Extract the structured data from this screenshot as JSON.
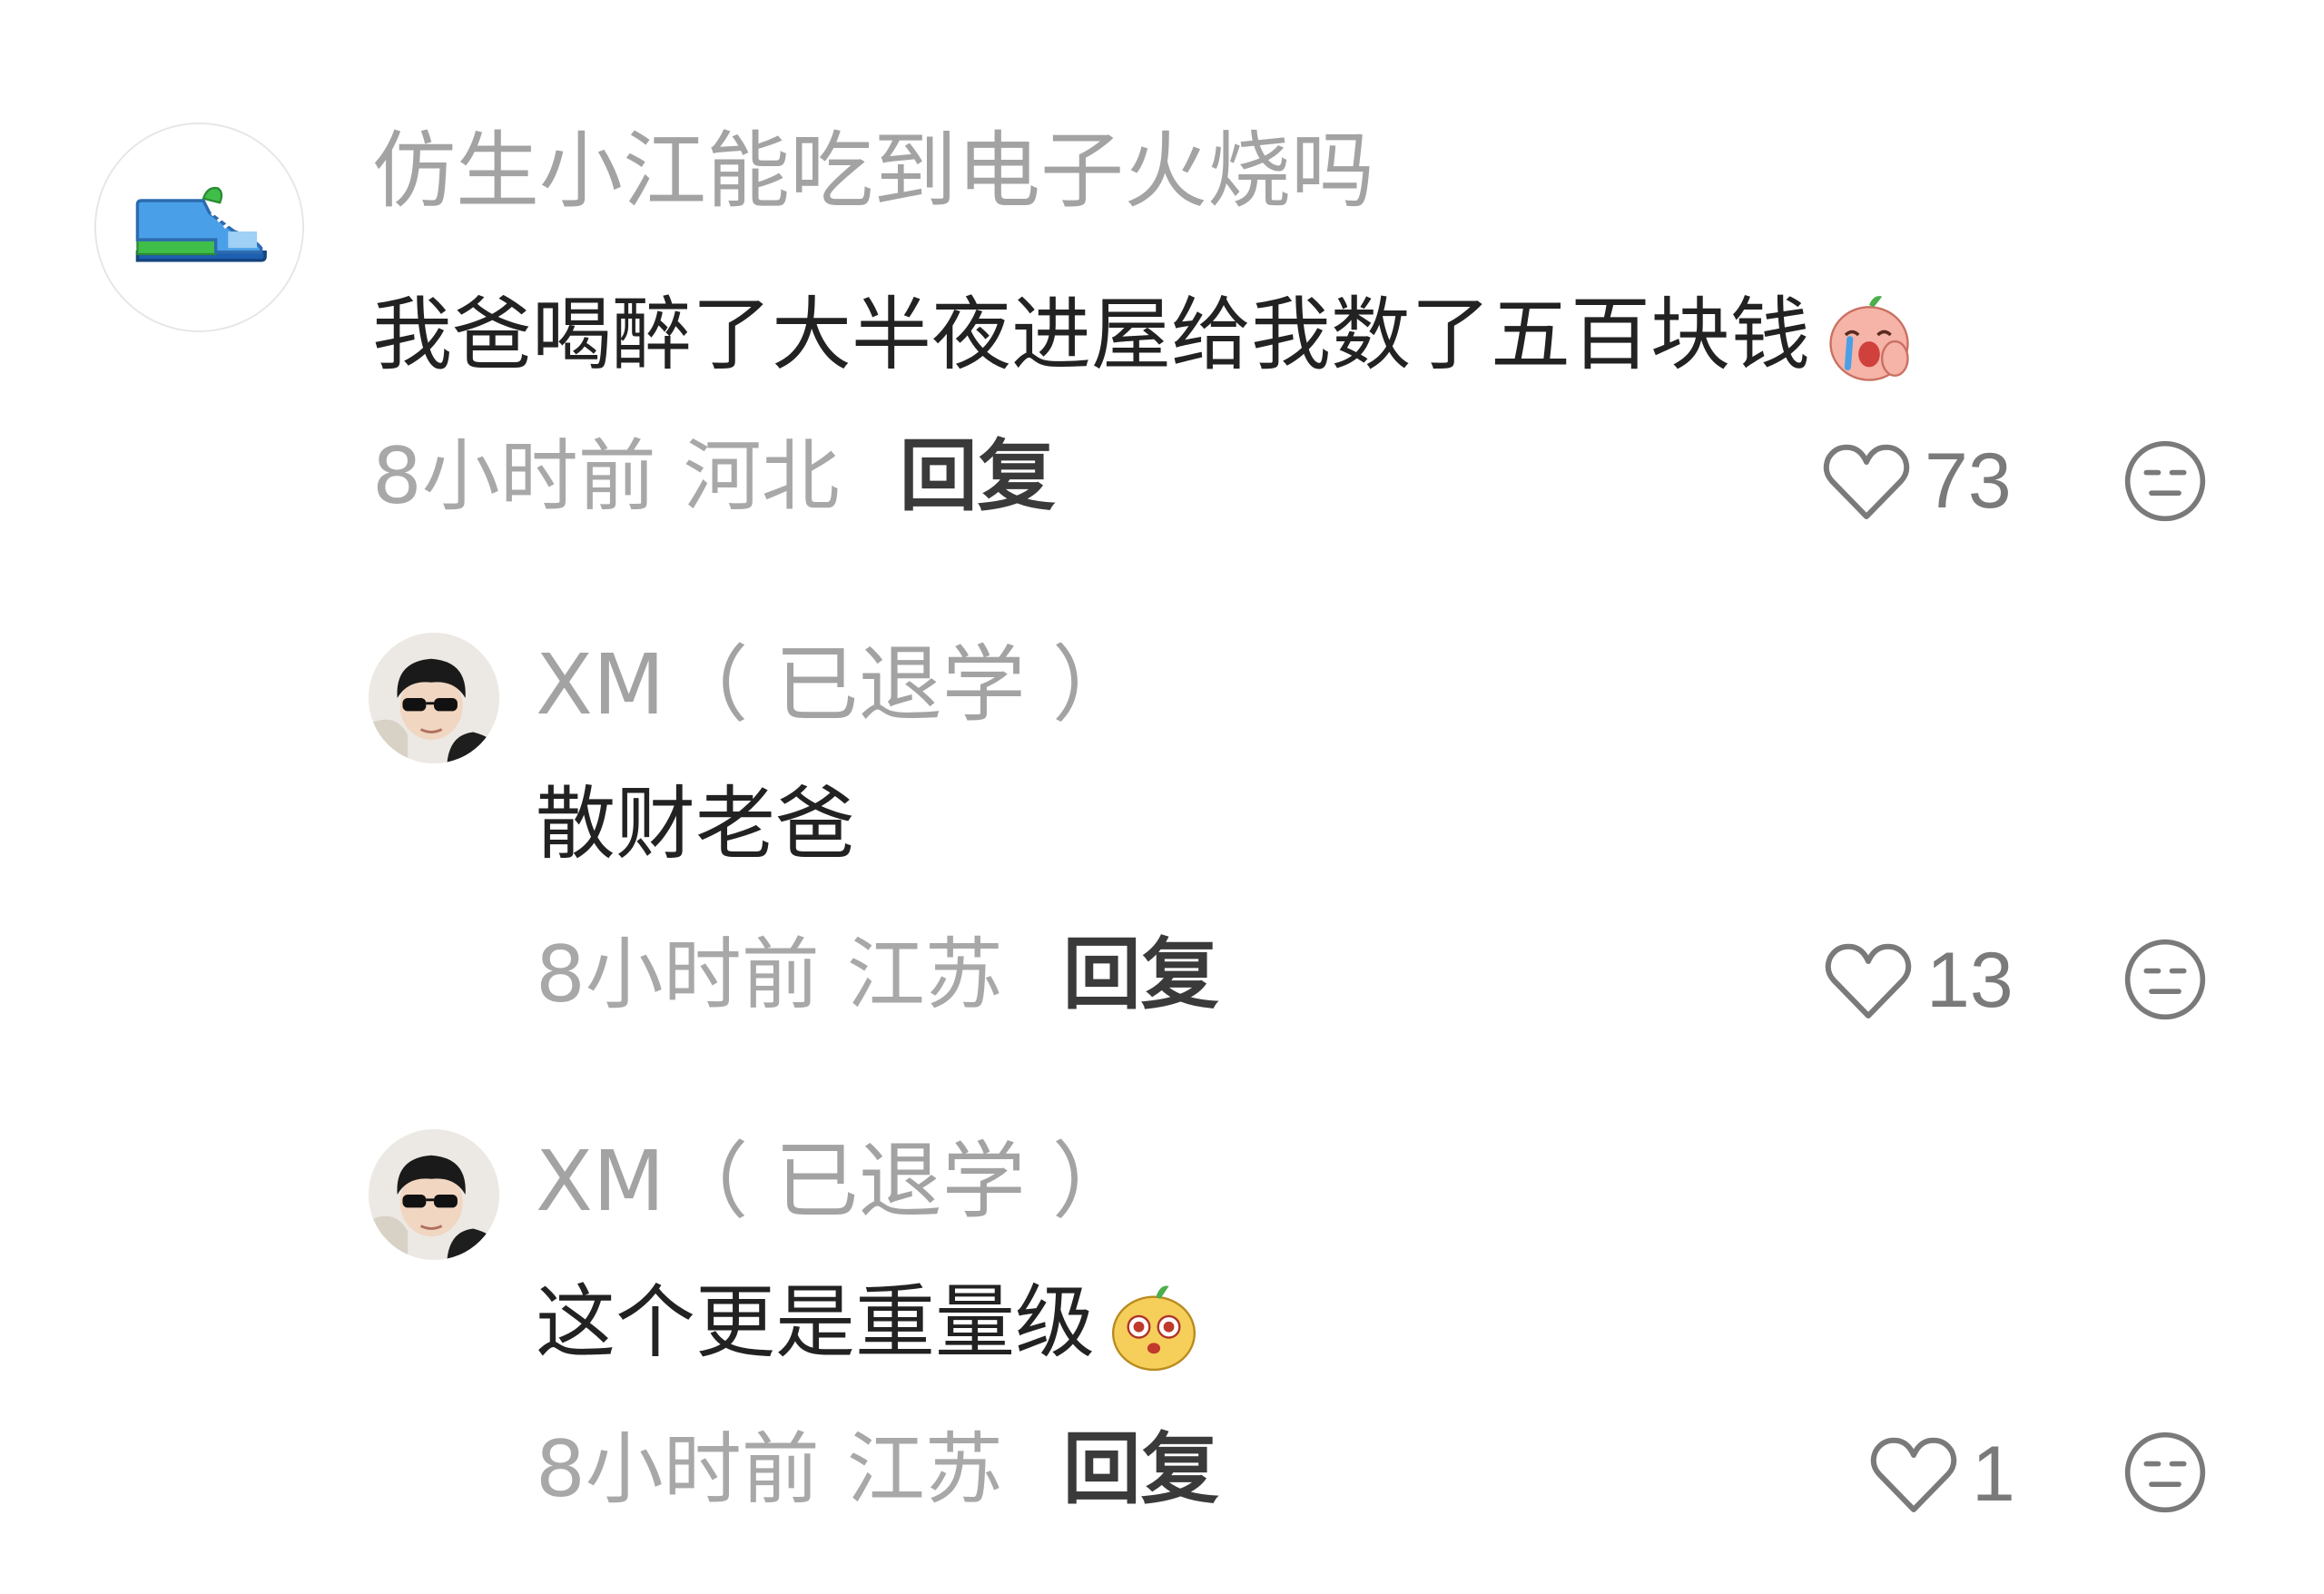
{
  "comment": {
    "avatar_icon": "sneaker-icon",
    "username": "仿生小江能吃到电子火烧吗",
    "content": "我爸喝醉了大半夜进屋给我数了五百块钱",
    "emoji": "crying-laughing-emoji",
    "time": "8小时前",
    "location": "河北",
    "reply_label": "回复",
    "like_count": "73",
    "replies": [
      {
        "avatar": "boy-sunglasses-avatar",
        "username": "XM（ 已退学 ）",
        "content": "散财老爸",
        "time": "8小时前",
        "location": "江苏",
        "reply_label": "回复",
        "like_count": "13"
      },
      {
        "avatar": "boy-sunglasses-avatar",
        "username": "XM（ 已退学 ）",
        "content": "这个更是重量级",
        "emoji": "shocked-emoji",
        "time": "8小时前",
        "location": "江苏",
        "reply_label": "回复",
        "like_count": "1"
      }
    ]
  },
  "colors": {
    "username": "#a3a3a3",
    "content": "#222222",
    "meta": "#a8a8a8",
    "reply_button": "#3a3a3a",
    "icon": "#7a7a7a"
  }
}
